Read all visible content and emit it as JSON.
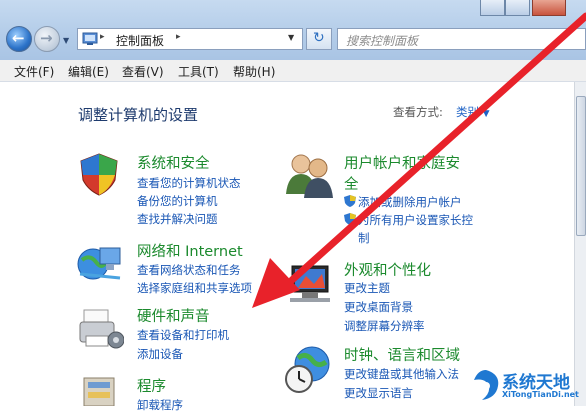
{
  "address": {
    "breadcrumb": "控制面板",
    "separator": "▸"
  },
  "search": {
    "placeholder": "搜索控制面板"
  },
  "menu": [
    "文件(F)",
    "编辑(E)",
    "查看(V)",
    "工具(T)",
    "帮助(H)"
  ],
  "page": {
    "title": "调整计算机的设置",
    "view_label": "查看方式:",
    "view_value": "类别"
  },
  "categories": [
    {
      "title": "系统和安全",
      "links": [
        "查看您的计算机状态",
        "备份您的计算机",
        "查找并解决问题"
      ]
    },
    {
      "title": "网络和 Internet",
      "links": [
        "查看网络状态和任务",
        "选择家庭组和共享选项"
      ]
    },
    {
      "title": "硬件和声音",
      "links": [
        "查看设备和打印机",
        "添加设备"
      ]
    },
    {
      "title": "程序",
      "links": [
        "卸载程序"
      ]
    },
    {
      "title_line1": "用户帐户和家庭安",
      "title_line2": "全",
      "links": [
        "添加或删除用户帐户",
        "为所有用户设置家长控",
        "制"
      ]
    },
    {
      "title": "外观和个性化",
      "links": [
        "更改主题",
        "更改桌面背景",
        "调整屏幕分辨率"
      ]
    },
    {
      "title": "时钟、语言和区域",
      "links": [
        "更改键盘或其他输入法",
        "更改显示语言"
      ]
    }
  ],
  "watermark": {
    "title": "系统天地",
    "subtitle": "XiTongTianDi.net"
  },
  "colors": {
    "link": "#1a57b5",
    "category": "#1b8a2d",
    "arrow": "#e8222a"
  }
}
